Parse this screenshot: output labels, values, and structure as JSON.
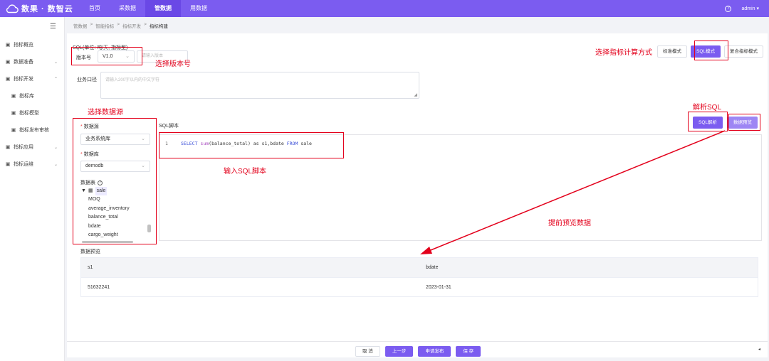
{
  "app": {
    "logo_text": "数果 · 数智云",
    "nav": [
      "首页",
      "采数据",
      "管数据",
      "用数据"
    ],
    "nav_active_index": 2,
    "user": "admin"
  },
  "sidebar": {
    "items": [
      {
        "label": "指标概览",
        "icon": "overview-icon",
        "sub": false,
        "arrow": ""
      },
      {
        "label": "数据准备",
        "icon": "database-icon",
        "sub": false,
        "arrow": "⌄"
      },
      {
        "label": "指标开发",
        "icon": "document-icon",
        "sub": false,
        "arrow": "⌃"
      },
      {
        "label": "指标库",
        "icon": "tools-icon",
        "sub": true,
        "arrow": ""
      },
      {
        "label": "指标模型",
        "icon": "model-icon",
        "sub": true,
        "arrow": ""
      },
      {
        "label": "指标发布审核",
        "icon": "review-icon",
        "sub": true,
        "arrow": ""
      },
      {
        "label": "指标应用",
        "icon": "app-icon",
        "sub": false,
        "arrow": "⌄"
      },
      {
        "label": "指标运维",
        "icon": "ops-icon",
        "sub": false,
        "arrow": "⌄"
      }
    ]
  },
  "breadcrumb": [
    "管数据",
    "智能指标",
    "指标开发",
    "指标构建"
  ],
  "form": {
    "sql_caption": "SQL(单位: 吨/天, 指标型)",
    "version_label": "版本号",
    "version_value": "V1.0",
    "version_placeholder": "请输入版本",
    "modes": [
      "标准模式",
      "SQL模式",
      "复合指标模式"
    ],
    "active_mode_index": 1,
    "caliber_label": "业务口径",
    "caliber_placeholder": "请输入200字以内的中文字符",
    "datasource_label": "数据源",
    "datasource_value": "业务系统库",
    "database_label": "数据库",
    "database_value": "demodb",
    "tables_label": "数据表",
    "table_name": "sale",
    "columns": [
      "MOQ",
      "average_inventory",
      "balance_total",
      "bdate",
      "cargo_weight"
    ],
    "sql_label": "SQL脚本",
    "sql_line_number": "1",
    "sql_parse_button": "SQL解析",
    "data_preview_button": "数据预览"
  },
  "preview": {
    "label": "数据预览",
    "columns": [
      "s1",
      "bdate"
    ],
    "rows": [
      [
        "51632241",
        "2023-01-31"
      ]
    ]
  },
  "footer": {
    "buttons": [
      "取 消",
      "上一步",
      "申请发布",
      "保 存"
    ]
  },
  "annotations": {
    "select_version": "选择版本号",
    "select_mode": "选择指标计算方式",
    "parse_sql": "解析SQL",
    "select_datasource": "选择数据源",
    "input_sql": "输入SQL脚本",
    "preview_ahead": "提前预览数据"
  },
  "colors": {
    "primary": "#7b5cf0",
    "annotation_red": "#e3001b"
  }
}
